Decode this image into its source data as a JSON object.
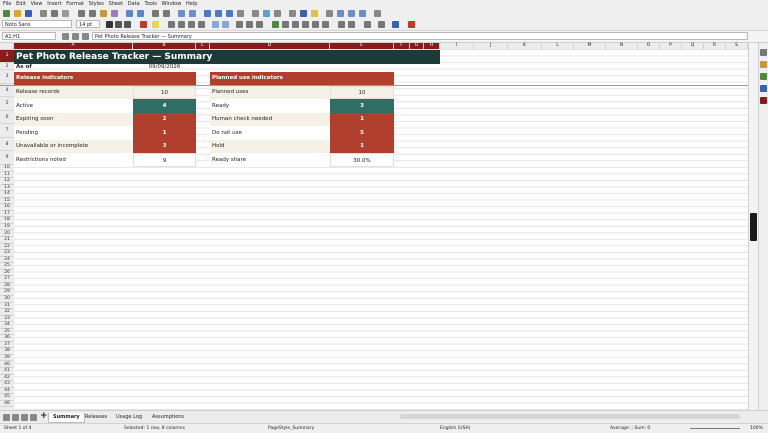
{
  "menu": [
    "File",
    "Edit",
    "View",
    "Insert",
    "Format",
    "Styles",
    "Sheet",
    "Data",
    "Tools",
    "Window",
    "Help"
  ],
  "font_name": "Noto Sans",
  "font_size": "14 pt",
  "name_box": "A1:H1",
  "formula": "Pet Photo Release Tracker — Summary",
  "columns": [
    "A",
    "B",
    "C",
    "D",
    "E",
    "F",
    "G",
    "H",
    "I",
    "J",
    "K",
    "L",
    "M",
    "N",
    "O",
    "P",
    "Q",
    "R",
    "S",
    "T",
    "U"
  ],
  "title": "Pet Photo Release Tracker — Summary",
  "as_of_label": "As of",
  "as_of_value": "09/09/2026",
  "left": {
    "header": "Release indicators",
    "rows": [
      {
        "label": "Release records",
        "value": "10"
      },
      {
        "label": "Active",
        "value": "4"
      },
      {
        "label": "Expiring soon",
        "value": "2"
      },
      {
        "label": "Pending",
        "value": "1"
      },
      {
        "label": "Unavailable or incomplete",
        "value": "3"
      },
      {
        "label": "Restrictions noted",
        "value": "9"
      }
    ]
  },
  "right": {
    "header": "Planned use indicators",
    "rows": [
      {
        "label": "Planned uses",
        "value": "10"
      },
      {
        "label": "Ready",
        "value": "3"
      },
      {
        "label": "Human check needed",
        "value": "1"
      },
      {
        "label": "Do not use",
        "value": "5"
      },
      {
        "label": "Hold",
        "value": "1"
      },
      {
        "label": "Ready share",
        "value": "30.0%"
      }
    ]
  },
  "tabs": [
    "Summary",
    "Releases",
    "Usage Log",
    "Assumptions"
  ],
  "status": {
    "sheet": "Sheet 1 of 4",
    "selection": "Selected: 1 row, 8 columns",
    "page_style": "PageStyle_Summary",
    "language": "English (USA)",
    "sum": "Average: ; Sum: 0",
    "zoom": "100%"
  },
  "colors": {
    "accent": "#b0402d",
    "teal": "#2f6e63",
    "dark": "#1e3a36"
  }
}
